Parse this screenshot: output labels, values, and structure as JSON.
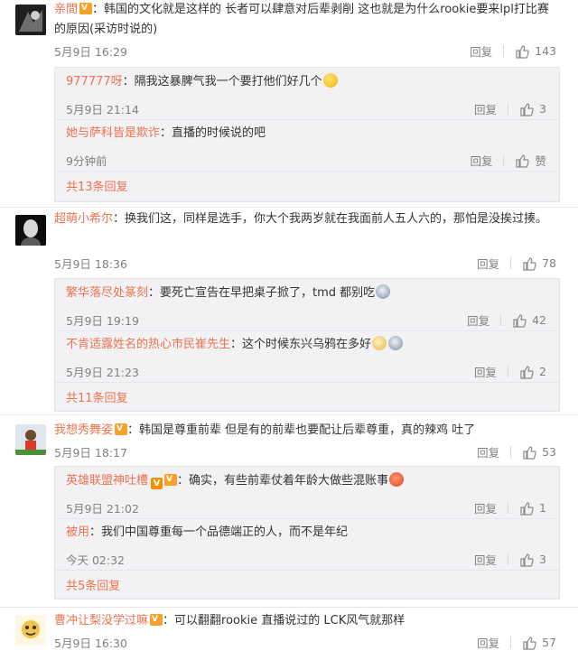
{
  "reply_label": "回复",
  "comments": [
    {
      "username": "亲間",
      "text": "：韩国的文化就是这样的 长者可以肆意对后辈剥削 这也就是为什么rookie要来lpl打比赛的原因(采访时说的)",
      "time": "5月9日 16:29",
      "likes": "143",
      "replies": [
        {
          "username": "977777呀",
          "text": "：隔我这暴脾气我一个要打他们好几个",
          "time": "5月9日 21:14",
          "likes": "3"
        },
        {
          "username": "她与萨科皆是欺诈",
          "text": "：直播的时候说的吧",
          "time": "9分钟前",
          "likes": "赞"
        }
      ],
      "more": "共13条回复"
    },
    {
      "username": "超萌小希尔",
      "text": "：换我们这，同样是选手，你大个我两岁就在我面前人五人六的，那怕是没挨过揍。",
      "time": "5月9日 18:36",
      "likes": "78",
      "replies": [
        {
          "username": "繁华落尽处篆刻",
          "text": "：要死亡宣告在早把桌子掀了，tmd 都别吃",
          "time": "5月9日 19:19",
          "likes": "42"
        },
        {
          "username": "不肯适露姓名的热心市民崔先生",
          "text": "：这个时候东兴乌鸦在多好",
          "time": "5月9日 21:23",
          "likes": "2"
        }
      ],
      "more": "共11条回复"
    },
    {
      "username": "我想秀舞姿",
      "text": "：韩国是尊重前辈 但是有的前辈也要配让后辈尊重，真的辣鸡 吐了",
      "time": "5月9日 18:17",
      "likes": "53",
      "replies": [
        {
          "username": "英雄联盟神吐槽",
          "text": "：确实，有些前辈仗着年龄大做些混账事",
          "time": "5月9日 21:02",
          "likes": "1"
        },
        {
          "username": "被用",
          "text": "：我们中国尊重每一个品德端正的人，而不是年纪",
          "time": "今天 02:32",
          "likes": "3"
        }
      ],
      "more": "共5条回复"
    },
    {
      "username": "曹冲让梨没学过嘛",
      "text": "：可以翻翻rookie 直播说过的 LCK风气就那样",
      "time": "5月9日 16:30",
      "likes": "57"
    }
  ],
  "colors": {
    "username": "#eb7350",
    "meta": "#808080",
    "reply_bg": "#f2f2f5",
    "vip_badge": "#f7a02a"
  },
  "icons": [
    "thumb-up-icon",
    "vip-badge-icon",
    "verified-v-icon",
    "emoji-icon"
  ]
}
